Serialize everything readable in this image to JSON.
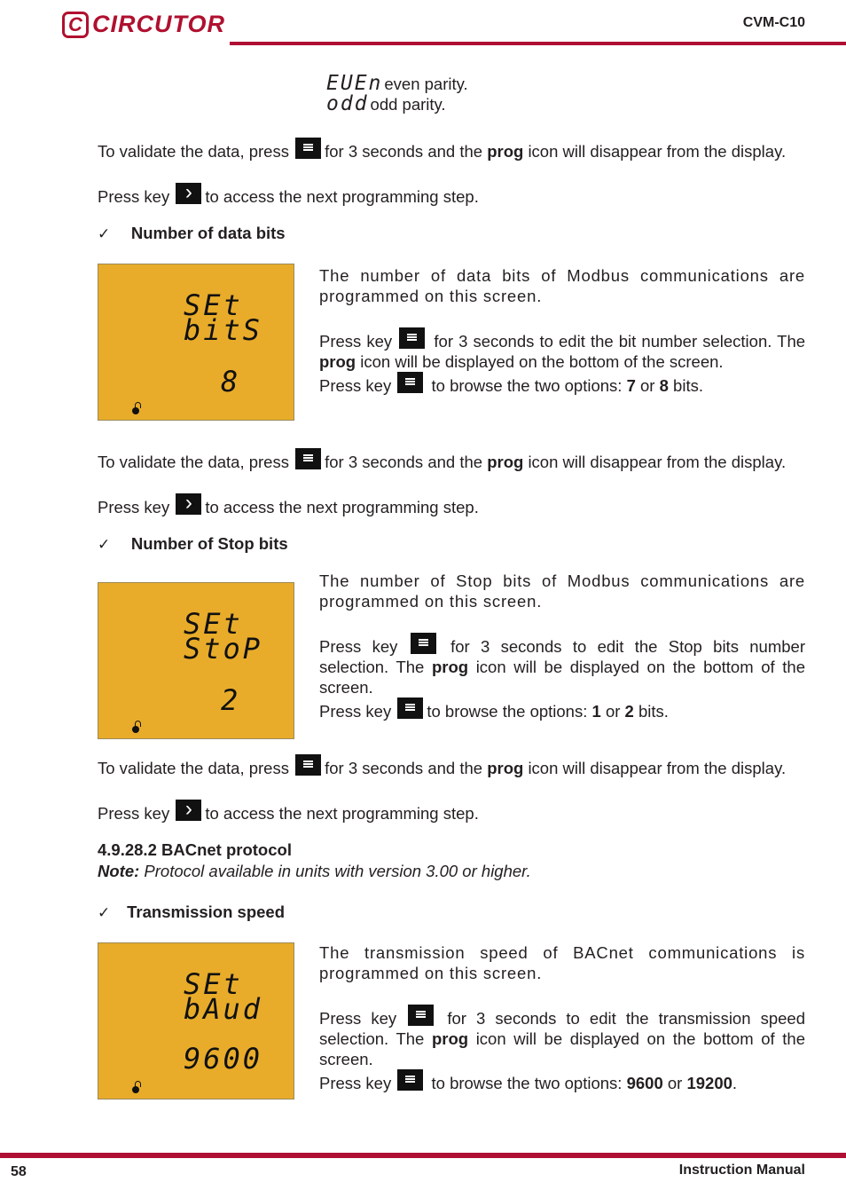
{
  "header": {
    "brand": "CIRCUTOR",
    "model": "CVM-C10",
    "accent": "#ae0f33"
  },
  "footer": {
    "page_number": "58",
    "manual": "Instruction Manual"
  },
  "parity": [
    {
      "lcd": "EUEn",
      "text": "even parity."
    },
    {
      "lcd": "odd",
      "text": "odd parity."
    }
  ],
  "common": {
    "validate_pre": "To validate the data, press",
    "validate_post_a": "for 3 seconds and the",
    "prog": "prog",
    "validate_post_b": "icon will disappear from the display.",
    "press_key": "Press key",
    "next_step": "to access the next programming step."
  },
  "sections": [
    {
      "title": "Number of data bits",
      "lcd": {
        "line1": "SEt",
        "line2": "bitS",
        "value": "8",
        "lcd_color": "#e8ac2a"
      },
      "desc1": "The number of data bits of Modbus communications are programmed on this screen.",
      "desc2_post": "for 3 seconds to edit the bit number selection. The",
      "desc3_post": "icon will be displayed on the bottom of the screen.",
      "desc4_post": "to browse the two options:",
      "opt1": "7",
      "or": "or",
      "opt2": "8",
      "tail": "bits."
    },
    {
      "title": "Number of Stop bits",
      "lcd": {
        "line1": "SEt",
        "line2": "StoP",
        "value": "2"
      },
      "desc1": "The number of Stop bits of Modbus communications are programmed on this screen.",
      "desc2_post": "for 3 seconds to edit the Stop bits number selection. The",
      "desc3_post": "icon will be displayed on the bottom of the screen.",
      "desc4_post": "to browse the options:",
      "opt1": "1",
      "or": "or",
      "opt2": "2",
      "tail": "bits."
    },
    {
      "title": "Transmission speed",
      "lcd": {
        "line1": "SEt",
        "line2": "bAud",
        "value": "9600"
      },
      "desc1": "The transmission speed of BACnet communications is programmed on this screen.",
      "desc2_post": "for 3 seconds to edit the transmission speed selection. The",
      "desc3_post": "icon will be displayed on the bottom of the screen.",
      "desc4_post": "to browse the two options:",
      "opt1": "9600",
      "or": "or",
      "opt2": "19200",
      "tail": "."
    }
  ],
  "bacnet": {
    "heading": "4.9.28.2 BACnet protocol",
    "note_label": "Note:",
    "note_text": "Protocol available in units with version 3.00 or higher."
  }
}
